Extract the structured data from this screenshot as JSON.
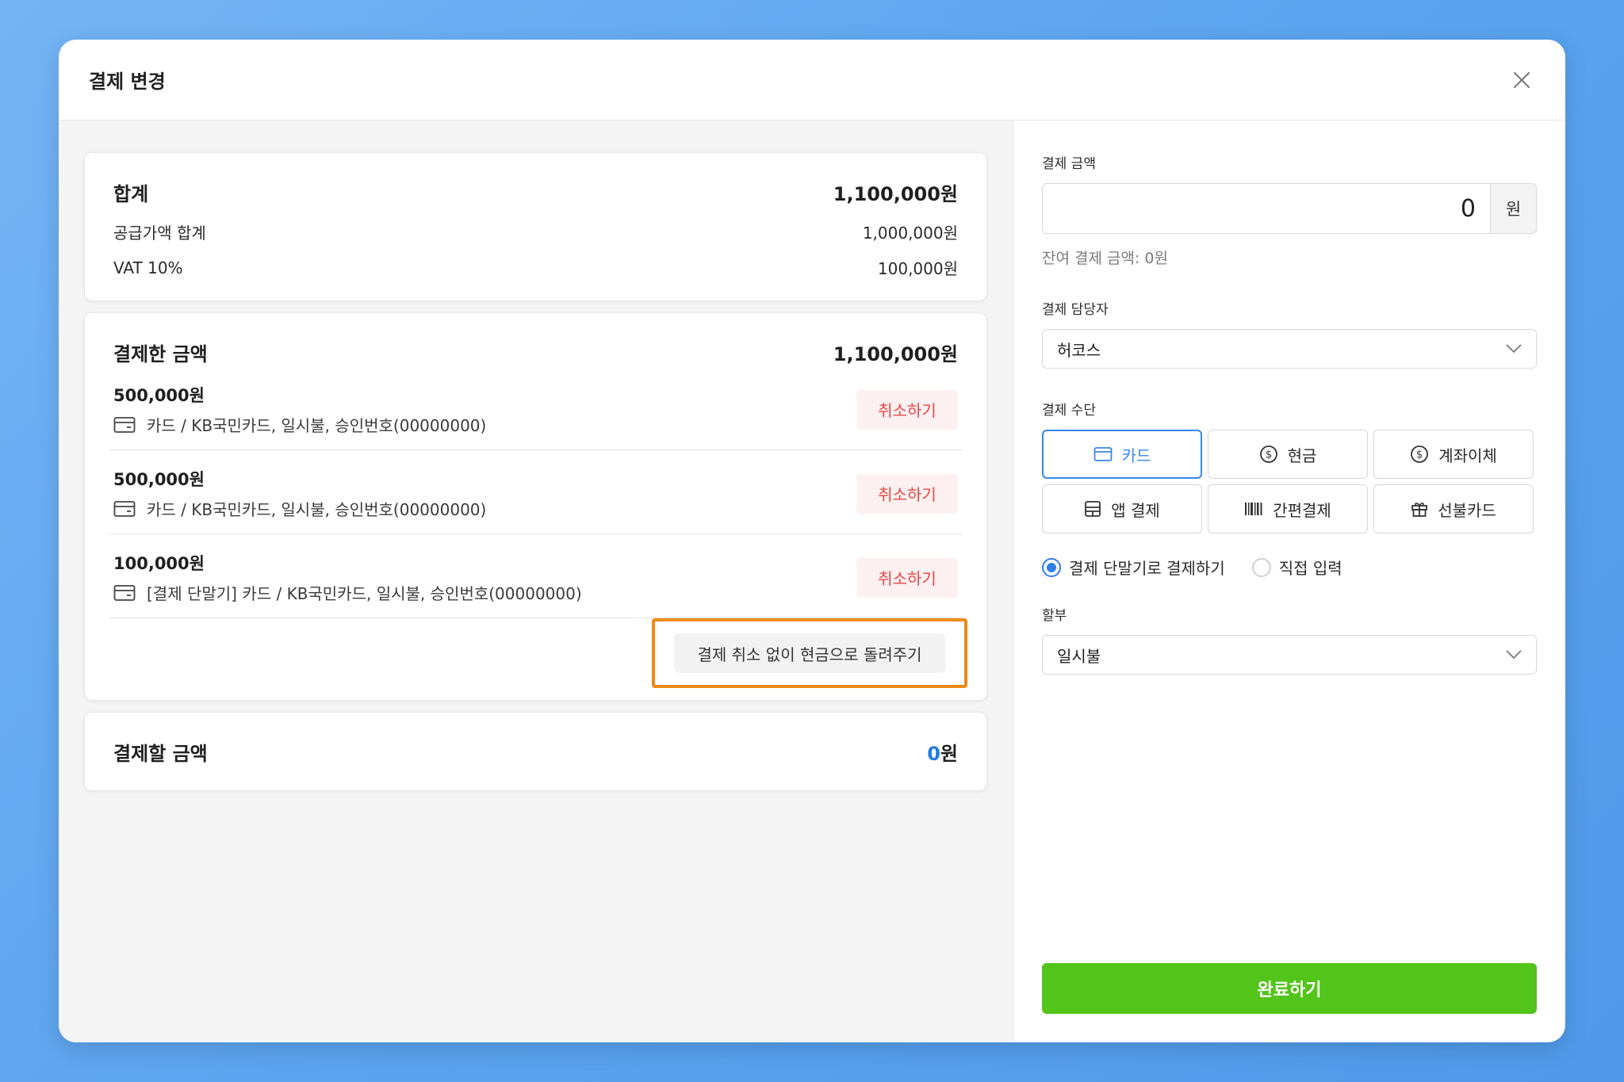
{
  "modal": {
    "title": "결제 변경"
  },
  "summary": {
    "title": "합계",
    "total": "1,100,000원",
    "supply_label": "공급가액 합계",
    "supply_value": "1,000,000원",
    "vat_label": "VAT 10%",
    "vat_value": "100,000원"
  },
  "paid": {
    "title": "결제한 금액",
    "total": "1,100,000원",
    "items": [
      {
        "amount": "500,000원",
        "detail": "카드 / KB국민카드, 일시불, 승인번호(00000000)",
        "cancel_label": "취소하기"
      },
      {
        "amount": "500,000원",
        "detail": "카드 / KB국민카드, 일시불, 승인번호(00000000)",
        "cancel_label": "취소하기"
      },
      {
        "amount": "100,000원",
        "detail": "[결제 단말기] 카드 / KB국민카드, 일시불, 승인번호(00000000)",
        "cancel_label": "취소하기"
      }
    ],
    "refund_label": "결제 취소 없이 현금으로 돌려주기"
  },
  "due": {
    "title": "결제할 금액",
    "amount": "0",
    "unit": "원"
  },
  "form": {
    "amount_label": "결제 금액",
    "amount_value": "0",
    "amount_unit": "원",
    "remain_text": "잔여 결제 금액: 0원",
    "manager_label": "결제 담당자",
    "manager_value": "허코스",
    "method_label": "결제 수단",
    "methods": [
      {
        "label": "카드",
        "icon": "card-icon",
        "active": true
      },
      {
        "label": "현금",
        "icon": "dollar-icon",
        "active": false
      },
      {
        "label": "계좌이체",
        "icon": "dollar-icon",
        "active": false
      },
      {
        "label": "앱 결제",
        "icon": "app-icon",
        "active": false
      },
      {
        "label": "간편결제",
        "icon": "barcode-icon",
        "active": false
      },
      {
        "label": "선불카드",
        "icon": "gift-icon",
        "active": false
      }
    ],
    "radio_terminal": "결제 단말기로 결제하기",
    "radio_manual": "직접 입력",
    "installment_label": "할부",
    "installment_value": "일시불",
    "complete_label": "완료하기"
  },
  "colors": {
    "accent": "#3a86e8",
    "complete": "#52c41a",
    "cancel": "#e54848",
    "highlight": "#f08a14"
  }
}
